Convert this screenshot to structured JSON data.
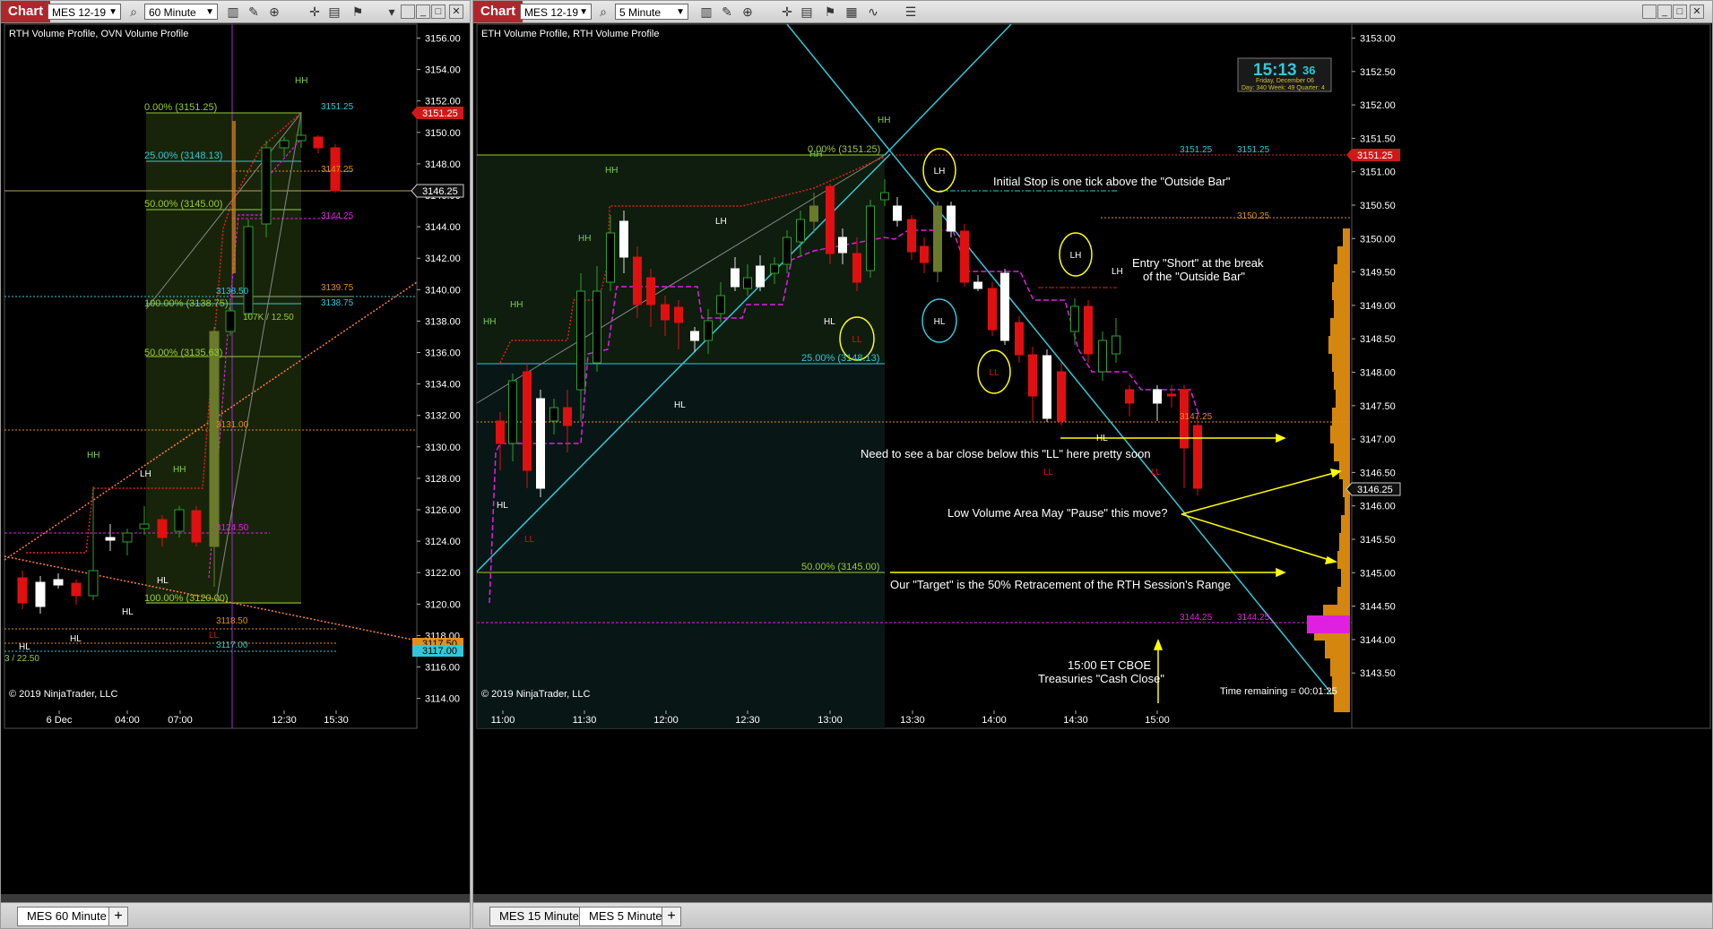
{
  "left": {
    "tab_label": "Chart",
    "instrument": "MES 12-19",
    "interval": "60 Minute",
    "indicators": "RTH Volume Profile, OVN Volume Profile",
    "copyright": "© 2019 NinjaTrader, LLC",
    "price_ticks": [
      "3156.00",
      "3154.00",
      "3152.00",
      "3150.00",
      "3148.00",
      "3146.00",
      "3144.00",
      "3142.00",
      "3140.00",
      "3138.00",
      "3136.00",
      "3134.00",
      "3132.00",
      "3130.00",
      "3128.00",
      "3126.00",
      "3124.00",
      "3122.00",
      "3120.00",
      "3118.00",
      "3116.00",
      "3114.00"
    ],
    "time_ticks": [
      "6 Dec",
      "04:00",
      "07:00",
      "12:30",
      "15:30"
    ],
    "price_flags": {
      "high": "3151.25",
      "last": "3146.25",
      "l1": "3117.50",
      "l2": "3117.00"
    },
    "fib_labels": [
      "0.00% (3151.25)",
      "25.00% (3148.13)",
      "50.00% (3145.00)",
      "100.00% (3138.75)",
      "50.00% (3135.63)",
      "100.00% (3120.00)"
    ],
    "level_labels": [
      "3151.25",
      "3147.25",
      "3144.25",
      "3139.75",
      "3138.50",
      "3138.75",
      "3131.00",
      "3124.50",
      "3118.50",
      "3117.00"
    ],
    "volume_label": "107K / 12.50",
    "partial_label": "3 / 22.50",
    "swing_labels": [
      "HH",
      "HH",
      "HH",
      "LH",
      "HL",
      "HL",
      "HL",
      "HL",
      "LL"
    ],
    "bottom_tab": "MES  60 Minute",
    "add_tab": "+"
  },
  "right": {
    "tab_label": "Chart",
    "instrument": "MES 12-19",
    "interval": "5 Minute",
    "indicators": "ETH Volume Profile, RTH Volume Profile",
    "copyright": "© 2019 NinjaTrader, LLC",
    "price_ticks": [
      "3153.00",
      "3152.50",
      "3152.00",
      "3151.50",
      "3151.00",
      "3150.50",
      "3150.00",
      "3149.50",
      "3149.00",
      "3148.50",
      "3148.00",
      "3147.50",
      "3147.00",
      "3146.50",
      "3146.00",
      "3145.50",
      "3145.00",
      "3144.50",
      "3144.00",
      "3143.50"
    ],
    "time_ticks": [
      "11:00",
      "11:30",
      "12:00",
      "12:30",
      "13:00",
      "13:30",
      "14:00",
      "14:30",
      "15:00"
    ],
    "price_flags": {
      "high": "3151.25",
      "last": "3146.25"
    },
    "fib_labels": [
      "0.00% (3151.25)",
      "25.00% (3148.13)",
      "50.00% (3145.00)"
    ],
    "level_labels": [
      "3151.25",
      "3151.25",
      "3150.25",
      "3147.25",
      "3144.25",
      "3144.25"
    ],
    "clock": {
      "time": "15:13",
      "seconds": "36",
      "date": "Friday, December 06",
      "info": "Day: 340  Week: 49  Quarter: 4"
    },
    "time_remaining": "Time remaining = 00:01:25",
    "annotations": {
      "stop": "Initial Stop is one tick above the \"Outside Bar\"",
      "entry1": "Entry \"Short\" at the break",
      "entry2": "of the \"Outside Bar\"",
      "close_below": "Need to see a bar close below this \"LL\" here pretty soon",
      "low_volume": "Low Volume Area May \"Pause\" this move?",
      "target": "Our \"Target\" is the 50% Retracement of the RTH Session's Range",
      "cboe1": "15:00 ET CBOE",
      "cboe2": "Treasuries \"Cash Close\""
    },
    "circle_labels": {
      "lh1": "LH",
      "lh2": "LH",
      "hl": "HL",
      "ll1": "LL",
      "ll2": "LL"
    },
    "swing_labels": [
      "HH",
      "HH",
      "HH",
      "HH",
      "HH",
      "HH",
      "LH",
      "LH",
      "HL",
      "HL",
      "HL",
      "HL",
      "LL",
      "LL",
      "LL"
    ],
    "bottom_tabs": [
      "MES  15 Minute",
      "MES  5 Minute"
    ],
    "add_tab": "+"
  },
  "colors": {
    "up": "#2ea02e",
    "down": "#e01010",
    "fib": "#9acd32",
    "cyan": "#30c8d8",
    "magenta": "#e020e0",
    "orange": "#e0901a",
    "profile": "#d4860f",
    "flag_red": "#d01818"
  }
}
